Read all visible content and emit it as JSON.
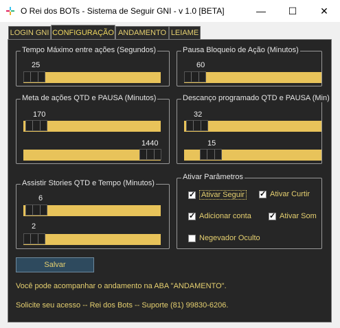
{
  "window": {
    "title": "O Rei dos BOTs - Sistema de Seguir GNI - v 1.0 [BETA]",
    "minimize_glyph": "—",
    "maximize_glyph": "☐",
    "close_glyph": "✕"
  },
  "tabs": [
    {
      "label": "LOGIN GNI",
      "active": false
    },
    {
      "label": "CONFIGURAÇÃO",
      "active": true
    },
    {
      "label": "ANDAMENTO",
      "active": false
    },
    {
      "label": "LEIAME",
      "active": false
    }
  ],
  "groups": {
    "tempo_maximo": {
      "label": "Tempo Máximo entre ações (Segundos)",
      "slider": {
        "value": "25"
      }
    },
    "pausa_bloqueio": {
      "label": "Pausa Bloqueio de Ação (Minutos)",
      "slider": {
        "value": "60"
      }
    },
    "meta_acoes": {
      "label": "Meta de ações QTD e PAUSA (Minutos)",
      "slider1": {
        "value": "170"
      },
      "slider2": {
        "value": "1440"
      }
    },
    "descanco": {
      "label": "Descanço programado QTD e PAUSA (Min)",
      "slider1": {
        "value": "32"
      },
      "slider2": {
        "value": "15"
      }
    },
    "stories": {
      "label": "Assistir Stories QTD e Tempo (Minutos)",
      "slider1": {
        "value": "6"
      },
      "slider2": {
        "value": "2"
      }
    },
    "ativar": {
      "label": "Ativar Parâmetros",
      "checkboxes": [
        {
          "label": "Ativar Seguir",
          "checked": true
        },
        {
          "label": "Ativar Curtir",
          "checked": true
        },
        {
          "label": "Adicionar conta",
          "checked": true
        },
        {
          "label": "Ativar Som",
          "checked": true
        },
        {
          "label": "Negevador Oculto",
          "checked": false
        }
      ]
    }
  },
  "save_button": {
    "label": "Salvar"
  },
  "info": {
    "line1": "Você pode acompanhar o andamento na ABA \"ANDAMENTO\".",
    "line2": "Solicite seu acesso -- Rei dos Bots -- Suporte (81) 99830-6206."
  },
  "colors": {
    "accent_text": "#e6d070",
    "track": "#e8c35a",
    "panel_bg": "#262626",
    "button_bg": "#2e4a5e"
  }
}
